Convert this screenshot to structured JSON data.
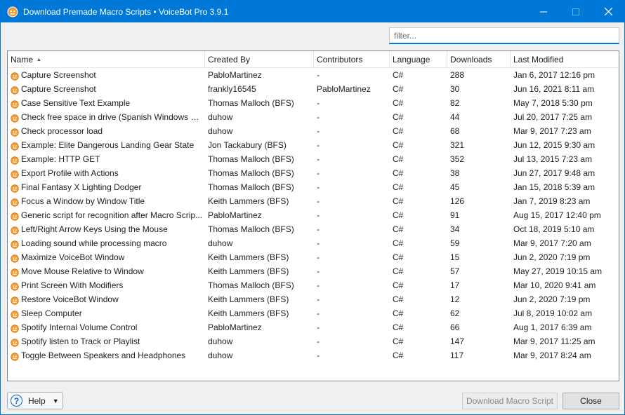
{
  "window": {
    "title": "Download Premade Macro Scripts • VoiceBot Pro 3.9.1",
    "accent": "#0078d7"
  },
  "filter": {
    "placeholder": "filter..."
  },
  "columns": {
    "name": "Name",
    "created_by": "Created By",
    "contributors": "Contributors",
    "language": "Language",
    "downloads": "Downloads",
    "last_modified": "Last Modified",
    "sort_indicator": "▲"
  },
  "rows": [
    {
      "name": "Capture Screenshot",
      "created_by": "PabloMartinez",
      "contributors": "-",
      "language": "C#",
      "downloads": "288",
      "last_modified": "Jan 6, 2017 12:16 pm"
    },
    {
      "name": "Capture Screenshot",
      "created_by": "frankly16545",
      "contributors": "PabloMartinez",
      "language": "C#",
      "downloads": "30",
      "last_modified": "Jun 16, 2021 8:11 am"
    },
    {
      "name": "Case Sensitive Text Example",
      "created_by": "Thomas Malloch (BFS)",
      "contributors": "-",
      "language": "C#",
      "downloads": "82",
      "last_modified": "May 7, 2018 5:30 pm"
    },
    {
      "name": "Check free space in drive (Spanish Windows On...",
      "created_by": "duhow",
      "contributors": "-",
      "language": "C#",
      "downloads": "44",
      "last_modified": "Jul 20, 2017 7:25 am"
    },
    {
      "name": "Check processor load",
      "created_by": "duhow",
      "contributors": "-",
      "language": "C#",
      "downloads": "68",
      "last_modified": "Mar 9, 2017 7:23 am"
    },
    {
      "name": "Example: Elite Dangerous Landing Gear State",
      "created_by": "Jon Tackabury (BFS)",
      "contributors": "-",
      "language": "C#",
      "downloads": "321",
      "last_modified": "Jun 12, 2015 9:30 am"
    },
    {
      "name": "Example: HTTP GET",
      "created_by": "Thomas Malloch (BFS)",
      "contributors": "-",
      "language": "C#",
      "downloads": "352",
      "last_modified": "Jul 13, 2015 7:23 am"
    },
    {
      "name": "Export Profile with Actions",
      "created_by": "Thomas Malloch (BFS)",
      "contributors": "-",
      "language": "C#",
      "downloads": "38",
      "last_modified": "Jun 27, 2017 9:48 am"
    },
    {
      "name": "Final Fantasy X Lighting Dodger",
      "created_by": "Thomas Malloch (BFS)",
      "contributors": "-",
      "language": "C#",
      "downloads": "45",
      "last_modified": "Jan 15, 2018 5:39 am"
    },
    {
      "name": "Focus a Window by Window Title",
      "created_by": "Keith Lammers (BFS)",
      "contributors": "-",
      "language": "C#",
      "downloads": "126",
      "last_modified": "Jan 7, 2019 8:23 am"
    },
    {
      "name": "Generic script for recognition after Macro Scrip...",
      "created_by": "PabloMartinez",
      "contributors": "-",
      "language": "C#",
      "downloads": "91",
      "last_modified": "Aug 15, 2017 12:40 pm"
    },
    {
      "name": "Left/Right Arrow Keys Using the Mouse",
      "created_by": "Thomas Malloch (BFS)",
      "contributors": "-",
      "language": "C#",
      "downloads": "34",
      "last_modified": "Oct 18, 2019 5:10 am"
    },
    {
      "name": "Loading sound while processing macro",
      "created_by": "duhow",
      "contributors": "-",
      "language": "C#",
      "downloads": "59",
      "last_modified": "Mar 9, 2017 7:20 am"
    },
    {
      "name": "Maximize VoiceBot Window",
      "created_by": "Keith Lammers (BFS)",
      "contributors": "-",
      "language": "C#",
      "downloads": "15",
      "last_modified": "Jun 2, 2020 7:19 pm"
    },
    {
      "name": "Move Mouse Relative to Window",
      "created_by": "Keith Lammers (BFS)",
      "contributors": "-",
      "language": "C#",
      "downloads": "57",
      "last_modified": "May 27, 2019 10:15 am"
    },
    {
      "name": "Print Screen With Modifiers",
      "created_by": "Thomas Malloch (BFS)",
      "contributors": "-",
      "language": "C#",
      "downloads": "17",
      "last_modified": "Mar 10, 2020 9:41 am"
    },
    {
      "name": "Restore VoiceBot Window",
      "created_by": "Keith Lammers (BFS)",
      "contributors": "-",
      "language": "C#",
      "downloads": "12",
      "last_modified": "Jun 2, 2020 7:19 pm"
    },
    {
      "name": "Sleep Computer",
      "created_by": "Keith Lammers (BFS)",
      "contributors": "-",
      "language": "C#",
      "downloads": "62",
      "last_modified": "Jul 8, 2019 10:02 am"
    },
    {
      "name": "Spotify Internal Volume Control",
      "created_by": "PabloMartinez",
      "contributors": "-",
      "language": "C#",
      "downloads": "66",
      "last_modified": "Aug 1, 2017 6:39 am"
    },
    {
      "name": "Spotify listen to Track or Playlist",
      "created_by": "duhow",
      "contributors": "-",
      "language": "C#",
      "downloads": "147",
      "last_modified": "Mar 9, 2017 11:25 am"
    },
    {
      "name": "Toggle Between Speakers and Headphones",
      "created_by": "duhow",
      "contributors": "-",
      "language": "C#",
      "downloads": "117",
      "last_modified": "Mar 9, 2017 8:24 am"
    }
  ],
  "footer": {
    "help_label": "Help",
    "help_glyph": "?",
    "help_caret": "▼",
    "download_label": "Download Macro Script",
    "close_label": "Close"
  },
  "icons": {
    "app": "voicebot-app-icon",
    "script": "script-icon",
    "minimize": "minimize-icon",
    "maximize": "maximize-icon",
    "close": "close-icon"
  }
}
